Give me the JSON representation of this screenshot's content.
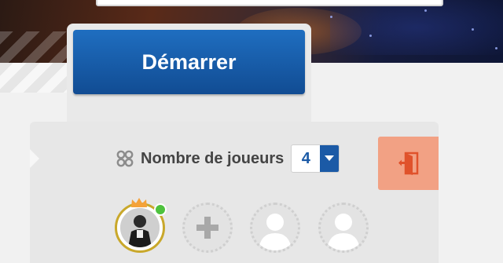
{
  "start": {
    "label": "Démarrer"
  },
  "lobby": {
    "players_label": "Nombre de joueurs",
    "player_count": "4"
  },
  "colors": {
    "primary": "#1a5ca8",
    "exit_bg": "#f2a184",
    "exit_icon": "#e0522b",
    "online": "#4ec23e"
  },
  "icons": {
    "players": "players-cluster-icon",
    "caret": "chevron-down-icon",
    "exit": "exit-door-icon",
    "add": "plus-icon",
    "empty_slot": "person-silhouette-icon",
    "host": "crown-icon"
  }
}
